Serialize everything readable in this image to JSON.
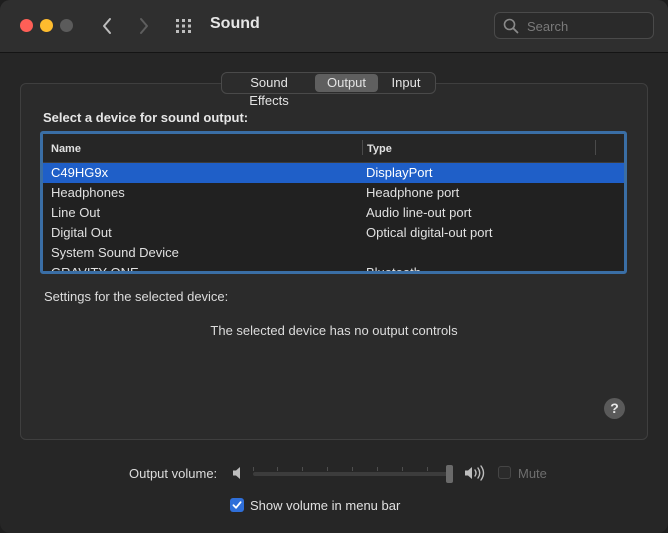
{
  "window": {
    "title": "Sound"
  },
  "search": {
    "placeholder": "Search"
  },
  "tabs": [
    {
      "label": "Sound Effects",
      "selected": false
    },
    {
      "label": "Output",
      "selected": true
    },
    {
      "label": "Input",
      "selected": false
    }
  ],
  "output": {
    "heading": "Select a device for sound output:",
    "columns": {
      "name": "Name",
      "type": "Type"
    },
    "devices": [
      {
        "name": "C49HG9x",
        "type": "DisplayPort",
        "selected": true
      },
      {
        "name": "Headphones",
        "type": "Headphone port",
        "selected": false
      },
      {
        "name": "Line Out",
        "type": "Audio line-out port",
        "selected": false
      },
      {
        "name": "Digital Out",
        "type": "Optical digital-out port",
        "selected": false
      },
      {
        "name": "System Sound Device",
        "type": "",
        "selected": false
      },
      {
        "name": "GRAVITY ONE",
        "type": "Bluetooth",
        "selected": false
      }
    ],
    "settings_label": "Settings for the selected device:",
    "no_controls_message": "The selected device has no output controls",
    "help_label": "?"
  },
  "volume": {
    "label": "Output volume:",
    "level": 1.0,
    "mute_label": "Mute",
    "muted": false
  },
  "menubar": {
    "label": "Show volume in menu bar",
    "checked": true
  },
  "colors": {
    "accent": "#1f5fc8",
    "table_focus_ring": "#3a6ea5",
    "close": "#ff5f57",
    "minimize": "#febc2e"
  }
}
